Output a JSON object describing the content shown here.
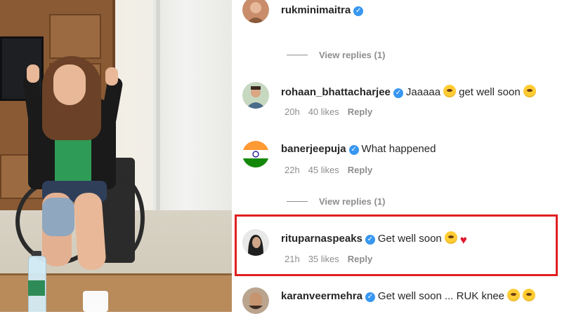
{
  "comments": [
    {
      "username": "rukminimaitra",
      "verified": true,
      "text": "",
      "view_replies": "View replies (1)",
      "avatar_color": "#c98d6b"
    },
    {
      "username": "rohaan_bhattacharjee",
      "verified": true,
      "text": "Jaaaaa",
      "text2": "get well soon",
      "time": "20h",
      "likes": "40 likes",
      "reply": "Reply",
      "avatar_color": "#9fb4a0"
    },
    {
      "username": "banerjeepuja",
      "verified": true,
      "text": "What happened",
      "time": "22h",
      "likes": "45 likes",
      "reply": "Reply",
      "view_replies": "View replies (1)",
      "avatar_color": "#ff9933"
    },
    {
      "username": "rituparnaspeaks",
      "verified": true,
      "text": "Get well soon",
      "time": "21h",
      "likes": "35 likes",
      "reply": "Reply",
      "highlighted": true,
      "avatar_color": "#3a3a3a"
    },
    {
      "username": "karanveermehra",
      "verified": true,
      "text": "Get well soon ... RUK knee",
      "avatar_color": "#7a6a5a"
    }
  ],
  "colors": {
    "highlight_border": "#e0201f",
    "verified_badge": "#3897f0",
    "meta_text": "#8e8e8e"
  }
}
